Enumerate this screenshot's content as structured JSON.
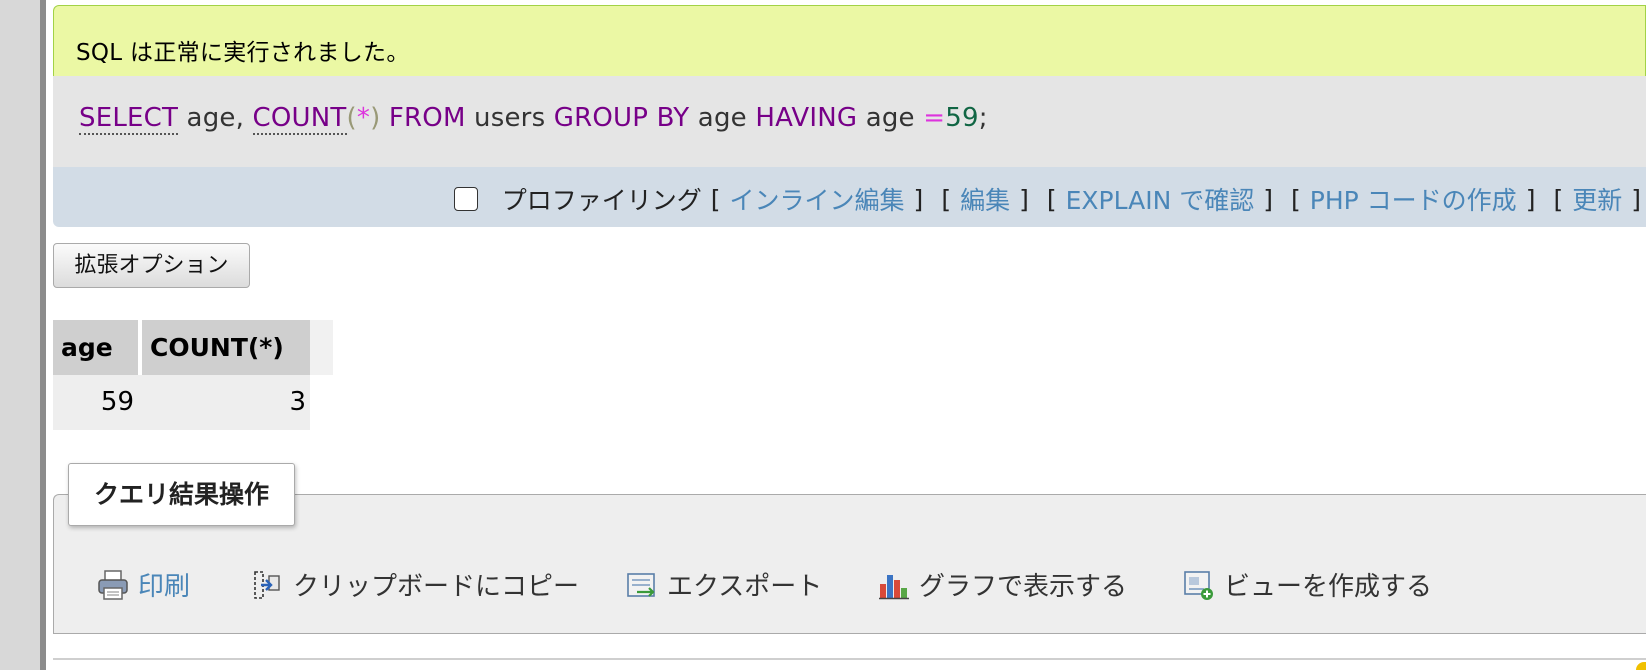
{
  "message": {
    "success": "SQL は正常に実行されました。"
  },
  "sql": {
    "tokens": [
      {
        "text": "SELECT",
        "cls": "fn"
      },
      {
        "text": " age, ",
        "cls": "plain"
      },
      {
        "text": "COUNT",
        "cls": "fn"
      },
      {
        "text": "(",
        "cls": "paren"
      },
      {
        "text": "*",
        "cls": "op"
      },
      {
        "text": ")",
        "cls": "paren"
      },
      {
        "text": " FROM",
        "cls": "kw"
      },
      {
        "text": " users ",
        "cls": "plain"
      },
      {
        "text": "GROUP BY",
        "cls": "kw"
      },
      {
        "text": " age ",
        "cls": "plain"
      },
      {
        "text": "HAVING",
        "cls": "kw"
      },
      {
        "text": " age ",
        "cls": "plain"
      },
      {
        "text": "=",
        "cls": "op"
      },
      {
        "text": "59",
        "cls": "num"
      },
      {
        "text": ";",
        "cls": "plain"
      }
    ]
  },
  "toolbar": {
    "profiling_label": "プロファイリング",
    "inline_edit": "インライン編集",
    "edit": "編集",
    "explain": "EXPLAIN で確認",
    "php_code": "PHP コードの作成",
    "refresh": "更新",
    "bracket_open": "[",
    "bracket_close": "]"
  },
  "extended_options": "拡張オプション",
  "table": {
    "headers": [
      "age",
      "COUNT(*)"
    ],
    "rows": [
      [
        "59",
        "3"
      ]
    ]
  },
  "operations": {
    "legend": "クエリ結果操作",
    "print": "印刷",
    "copy": "クリップボードにコピー",
    "export": "エクスポート",
    "chart": "グラフで表示する",
    "create_view": "ビューを作成する"
  },
  "colors": {
    "success_bg": "#ebf8a4",
    "sql_bg": "#e5e5e5",
    "toolbar_bg": "#d2dce6",
    "link": "#4a86b8",
    "keyword": "#770088"
  }
}
